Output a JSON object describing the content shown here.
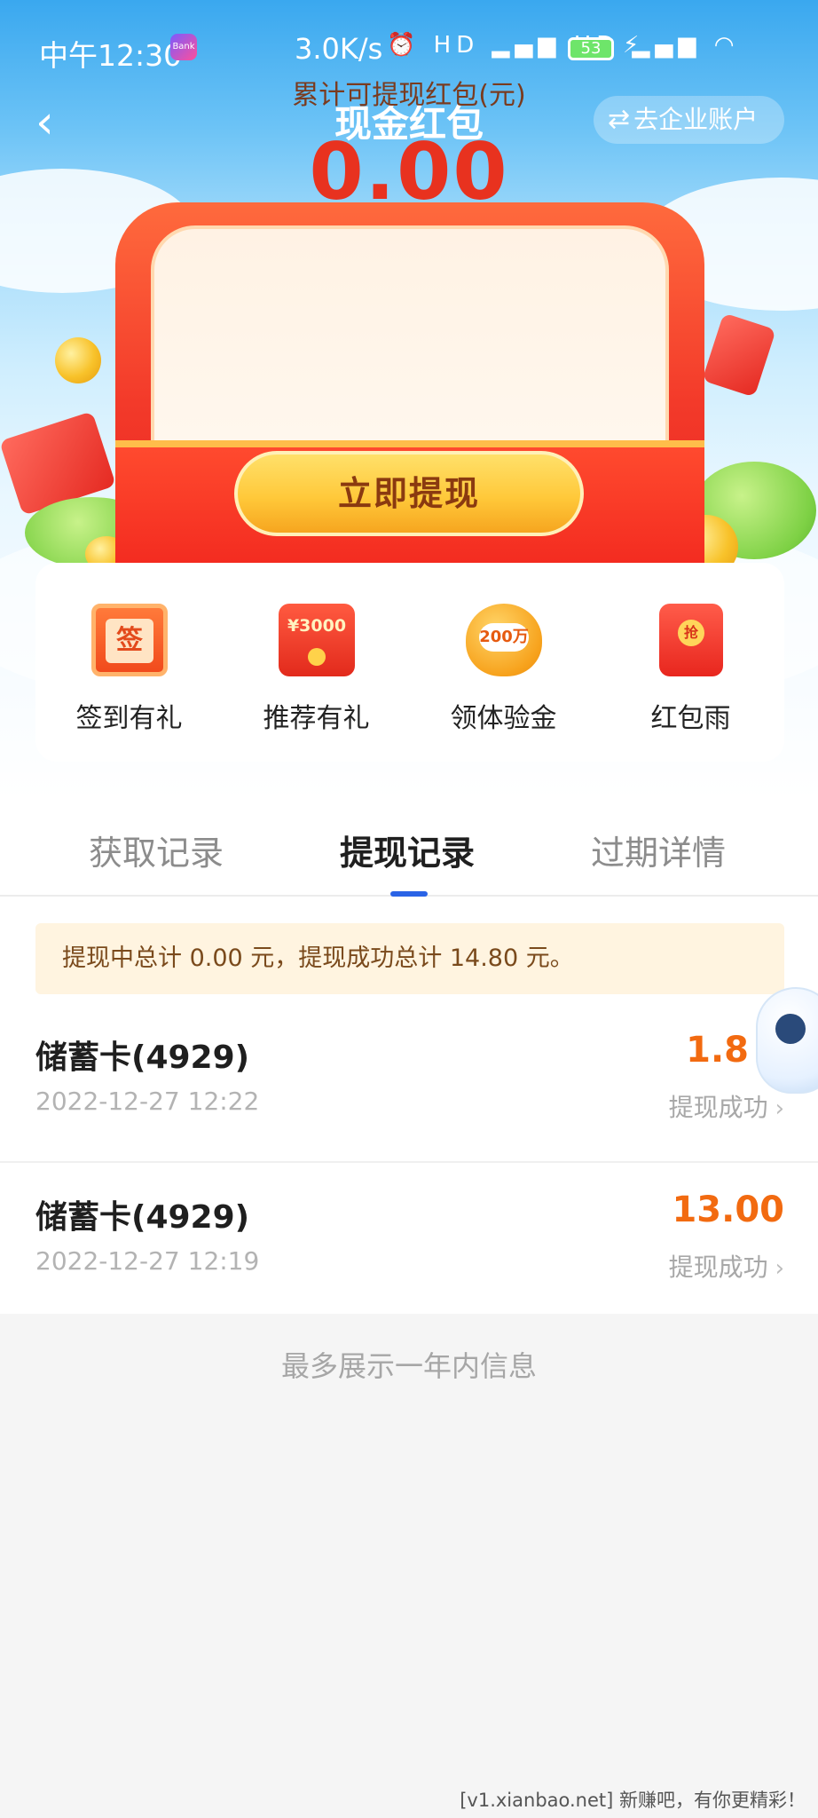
{
  "status_bar": {
    "time": "中午12:30",
    "app_icon_text": "Bank",
    "net_speed": "3.0K/s",
    "signal_icons": "⏰ HD ▂▄▆ HD ▂▄▆ ◠",
    "battery": "53",
    "charging_icon": "⚡"
  },
  "nav": {
    "back_icon": "‹",
    "title": "现金红包",
    "switch_icon": "⇄",
    "switch_label": "去企业账户"
  },
  "envelope": {
    "label": "累计可提现红包(元)",
    "amount": "0.00",
    "withdraw_button": "立即提现"
  },
  "actions": [
    {
      "label": "签到有礼",
      "icon": "sign-in-calendar-icon",
      "icon_text": "签"
    },
    {
      "label": "推荐有礼",
      "icon": "referral-envelope-icon",
      "icon_text": "¥3000"
    },
    {
      "label": "领体验金",
      "icon": "piggy-bank-icon",
      "icon_text": "200万"
    },
    {
      "label": "红包雨",
      "icon": "red-envelope-rain-icon",
      "icon_text": "抢"
    }
  ],
  "tabs": [
    {
      "label": "获取记录",
      "active": false
    },
    {
      "label": "提现记录",
      "active": true
    },
    {
      "label": "过期详情",
      "active": false
    }
  ],
  "notice": "提现中总计 0.00 元，提现成功总计 14.80 元。",
  "records": [
    {
      "title": "储蓄卡(4929)",
      "time": "2022-12-27 12:22",
      "amount": "1.8",
      "status": "提现成功"
    },
    {
      "title": "储蓄卡(4929)",
      "time": "2022-12-27 12:19",
      "amount": "13.00",
      "status": "提现成功"
    }
  ],
  "chevron": "›",
  "footer_note": "最多展示一年内信息",
  "watermark": "[v1.xianbao.net] 新赚吧，有你更精彩！",
  "colors": {
    "accent_blue": "#2a63e6",
    "amount_orange": "#f26a10",
    "envelope_red": "#f33a2a",
    "button_gold": "#ffc93a"
  }
}
